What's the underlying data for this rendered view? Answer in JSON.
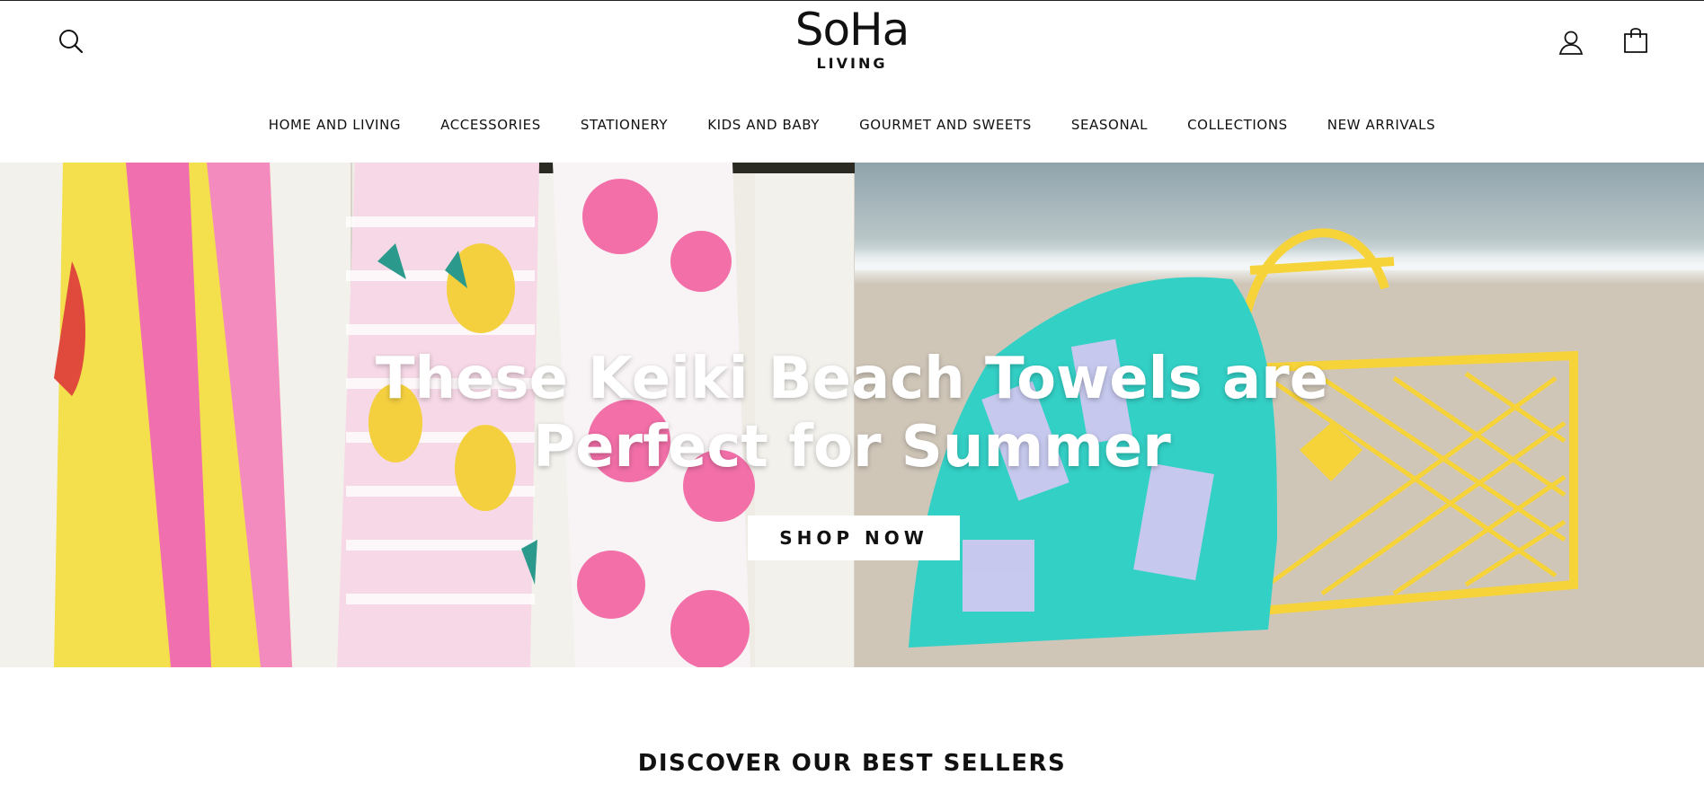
{
  "header": {
    "brand": "SoHa",
    "brand_sub": "LIVING",
    "icons": {
      "search": "search-icon",
      "account": "user-icon",
      "cart": "shopping-bag-icon"
    }
  },
  "nav": {
    "items": [
      {
        "label": "HOME AND LIVING"
      },
      {
        "label": "ACCESSORIES"
      },
      {
        "label": "STATIONERY"
      },
      {
        "label": "KIDS AND BABY"
      },
      {
        "label": "GOURMET AND SWEETS"
      },
      {
        "label": "SEASONAL"
      },
      {
        "label": "COLLECTIONS"
      },
      {
        "label": "NEW ARRIVALS"
      }
    ]
  },
  "hero": {
    "title_line1": "These Keiki Beach Towels are",
    "title_line2": "Perfect for Summer",
    "cta": "SHOP NOW"
  },
  "sections": {
    "best_sellers_title": "DISCOVER OUR BEST SELLERS"
  },
  "colors": {
    "text": "#111111",
    "button_bg": "#ffffff",
    "hero_text": "#ffffff",
    "towel_pink": "#f06fae",
    "towel_yellow": "#f4df4c",
    "towel_teal": "#33d0c6",
    "basket_yellow": "#f7d33a"
  }
}
